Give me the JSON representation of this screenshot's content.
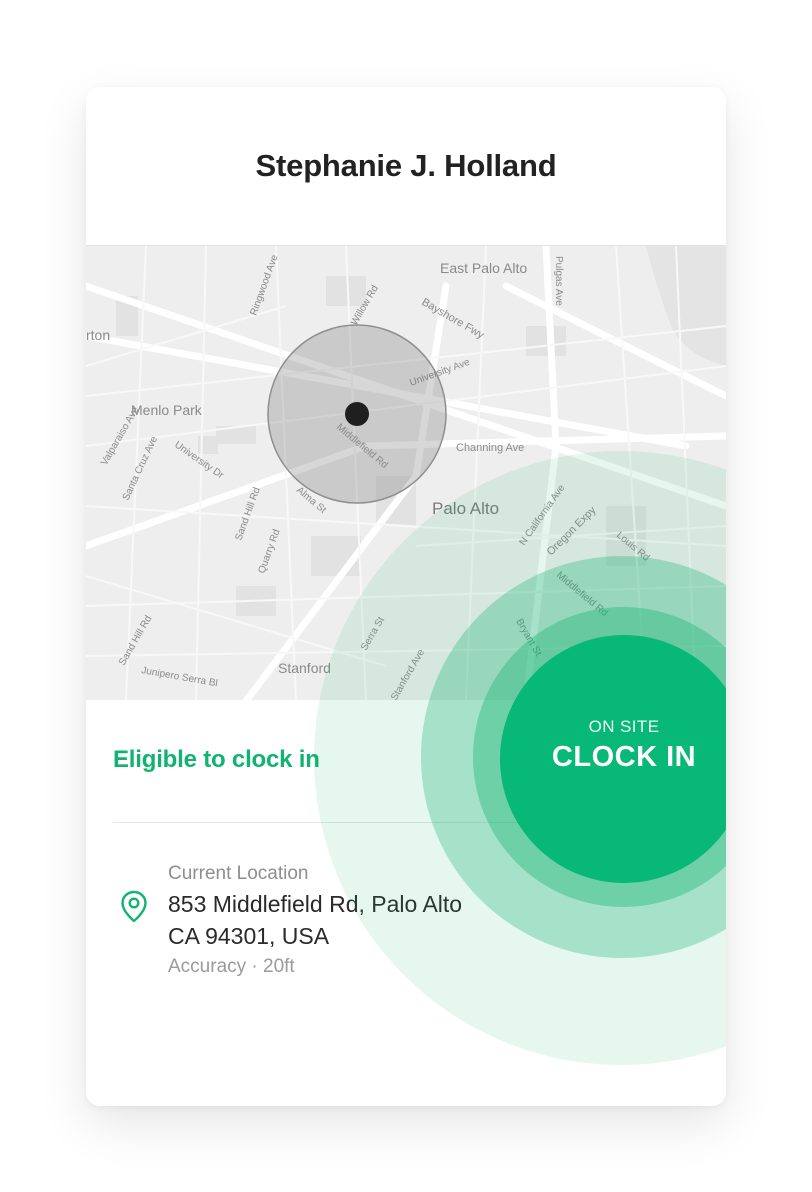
{
  "header": {
    "employee_name": "Stephanie J. Holland"
  },
  "map": {
    "labels": {
      "east_palo_alto": "East Palo Alto",
      "menlo_park": "Menlo Park",
      "palo_alto": "Palo Alto",
      "stanford": "Stanford",
      "atherton_partial": "rton",
      "bayshore_fwy": "Bayshore Fwy",
      "willow_rd": "Willow Rd",
      "university_ave": "University Ave",
      "middlefield_rd": "Middlefield Rd",
      "channing_ave": "Channing Ave",
      "alma_st": "Alma St",
      "oregon_expy": "Oregon Expy",
      "n_california_ave": "N California Ave",
      "louis_rd": "Louis Rd",
      "middlefield_rd_2": "Middlefield Rd",
      "bryant_st": "Bryant St",
      "pulgas_ave": "Pulgas Ave",
      "ringwood_ave": "Ringwood Ave",
      "valparaiso_ave": "Valparaiso Ave",
      "santa_cruz_ave": "Santa Cruz Ave",
      "university_dr": "University Dr",
      "sand_hill_rd": "Sand Hill Rd",
      "quarry_rd": "Quarry Rd",
      "junipero_serra_blvd": "Junipero Serra Bl",
      "serra_st": "Serra St",
      "stanford_ave": "Stanford Ave",
      "sand_hill_rd_2": "Sand Hill Rd"
    },
    "current_location_marker": "current-location"
  },
  "status": {
    "eligible_text": "Eligible to clock in"
  },
  "location": {
    "title": "Current Location",
    "address_line1": "853 Middlefield Rd, Palo Alto",
    "address_line2": "CA 94301, USA",
    "accuracy": "Accuracy · 20ft",
    "icon": "map-pin-icon"
  },
  "clock_button": {
    "sub_label": "ON SITE",
    "main_label": "CLOCK IN"
  },
  "colors": {
    "accent": "#08b877",
    "eligible_text": "#10b36f",
    "title_text": "#222222"
  }
}
